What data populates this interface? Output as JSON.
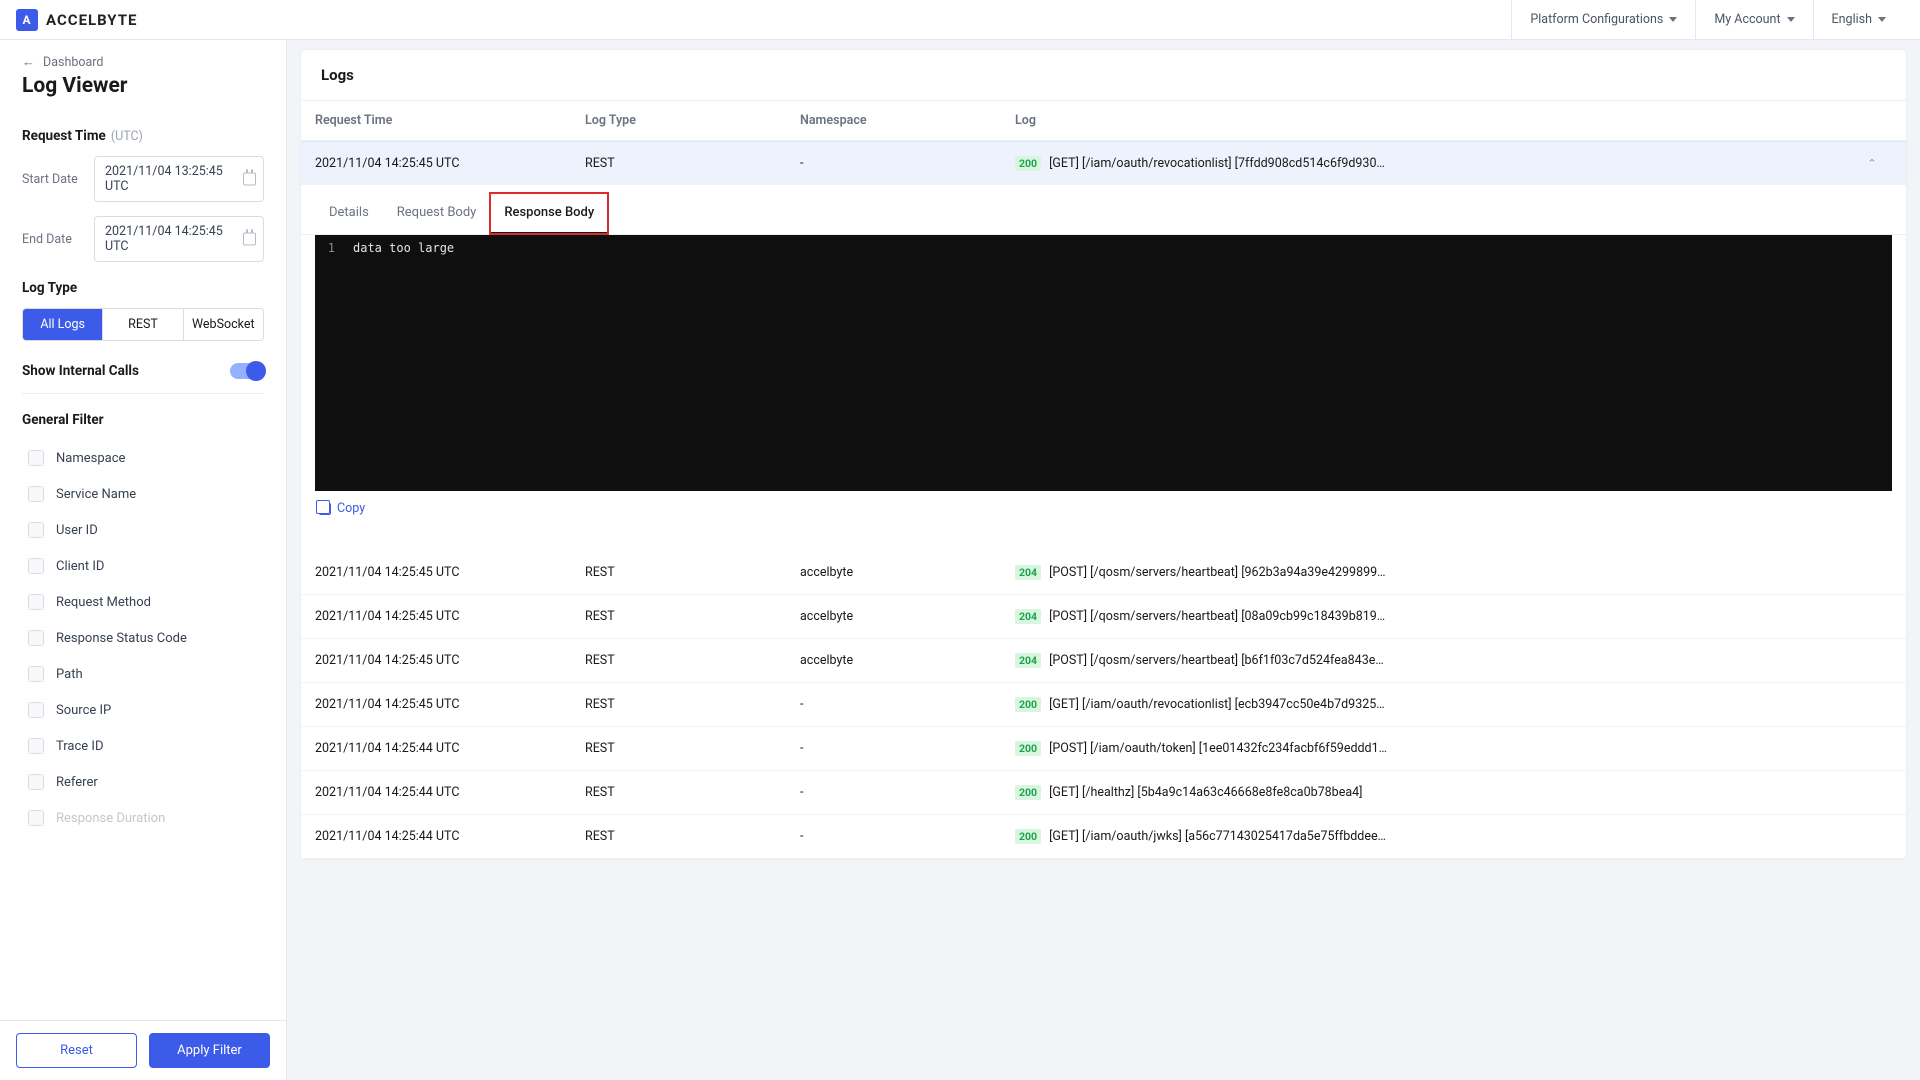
{
  "brand": "ACCELBYTE",
  "topnav": {
    "platform": "Platform Configurations",
    "account": "My Account",
    "lang": "English"
  },
  "breadcrumb": "Dashboard",
  "page_title": "Log Viewer",
  "request_time": {
    "label": "Request Time",
    "tz": "(UTC)"
  },
  "start": {
    "label": "Start Date",
    "value": "2021/11/04 13:25:45 UTC"
  },
  "end": {
    "label": "End Date",
    "value": "2021/11/04 14:25:45 UTC"
  },
  "log_type_label": "Log Type",
  "seg": {
    "all": "All Logs",
    "rest": "REST",
    "ws": "WebSocket"
  },
  "show_internal": "Show Internal Calls",
  "general_filter": "General Filter",
  "filters": [
    "Namespace",
    "Service Name",
    "User ID",
    "Client ID",
    "Request Method",
    "Response Status Code",
    "Path",
    "Source IP",
    "Trace ID",
    "Referer",
    "Response Duration"
  ],
  "reset": "Reset",
  "apply": "Apply Filter",
  "card_title": "Logs",
  "cols": {
    "rt": "Request Time",
    "lt": "Log Type",
    "ns": "Namespace",
    "log": "Log"
  },
  "rows": [
    {
      "time": "2021/11/04 14:25:45 UTC",
      "type": "REST",
      "ns": "-",
      "status": "200",
      "log": "[GET] [/iam/oauth/revocationlist] [7ffdd908cd514c6f9d930…",
      "expanded": true
    },
    {
      "time": "2021/11/04 14:25:45 UTC",
      "type": "REST",
      "ns": "accelbyte",
      "status": "204",
      "log": "[POST] [/qosm/servers/heartbeat] [962b3a94a39e4299899…"
    },
    {
      "time": "2021/11/04 14:25:45 UTC",
      "type": "REST",
      "ns": "accelbyte",
      "status": "204",
      "log": "[POST] [/qosm/servers/heartbeat] [08a09cb99c18439b819…"
    },
    {
      "time": "2021/11/04 14:25:45 UTC",
      "type": "REST",
      "ns": "accelbyte",
      "status": "204",
      "log": "[POST] [/qosm/servers/heartbeat] [b6f1f03c7d524fea843e…"
    },
    {
      "time": "2021/11/04 14:25:45 UTC",
      "type": "REST",
      "ns": "-",
      "status": "200",
      "log": "[GET] [/iam/oauth/revocationlist] [ecb3947cc50e4b7d9325…"
    },
    {
      "time": "2021/11/04 14:25:44 UTC",
      "type": "REST",
      "ns": "-",
      "status": "200",
      "log": "[POST] [/iam/oauth/token] [1ee01432fc234facbf6f59eddd1…"
    },
    {
      "time": "2021/11/04 14:25:44 UTC",
      "type": "REST",
      "ns": "-",
      "status": "200",
      "log": "[GET] [/healthz] [5b4a9c14a63c46668e8fe8ca0b78bea4]"
    },
    {
      "time": "2021/11/04 14:25:44 UTC",
      "type": "REST",
      "ns": "-",
      "status": "200",
      "log": "[GET] [/iam/oauth/jwks] [a56c77143025417da5e75ffbddee…"
    }
  ],
  "tabs": {
    "details": "Details",
    "req": "Request Body",
    "res": "Response Body"
  },
  "code": {
    "line": "1",
    "text": "data too large"
  },
  "copy": "Copy"
}
